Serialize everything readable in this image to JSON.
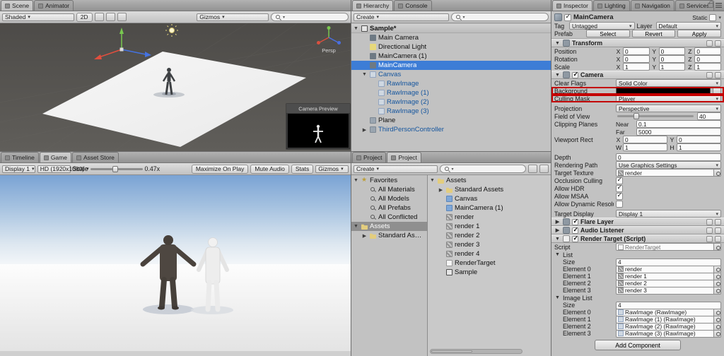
{
  "colors": {
    "selection_blue": "#3d7dd6",
    "annotation_red": "#c40000",
    "prefab_text_blue": "#14559e",
    "background_swatch": "#000000"
  },
  "scene": {
    "tabs": [
      {
        "label": "Scene",
        "active": true
      },
      {
        "label": "Animator"
      }
    ],
    "toolbar": {
      "shaded": "Shaded",
      "two_d": "2D",
      "gizmos": "Gizmos"
    },
    "persp": "Persp",
    "camera_preview": "Camera Preview"
  },
  "game": {
    "tabs": [
      {
        "label": "Timeline"
      },
      {
        "label": "Game",
        "active": true
      },
      {
        "label": "Asset Store"
      }
    ],
    "toolbar": {
      "display": "Display 1",
      "resolution": "HD (1920x1080)",
      "scale_label": "Scale",
      "scale_value": "0.47x",
      "maximize": "Maximize On Play",
      "mute": "Mute Audio",
      "stats": "Stats",
      "gizmos": "Gizmos"
    }
  },
  "hierarchy": {
    "tabs": [
      {
        "label": "Hierarchy",
        "active": true
      },
      {
        "label": "Console"
      }
    ],
    "create": "Create",
    "items": [
      {
        "label": "Sample*",
        "depth": 0,
        "arrow": "▼",
        "icon": "scene",
        "bold": true,
        "header": true
      },
      {
        "label": "Main Camera",
        "depth": 1,
        "icon": "camera"
      },
      {
        "label": "Directional Light",
        "depth": 1,
        "icon": "light"
      },
      {
        "label": "MainCamera (1)",
        "depth": 1,
        "icon": "camera"
      },
      {
        "label": "MainCamera",
        "depth": 1,
        "icon": "camera",
        "selected": true
      },
      {
        "label": "Canvas",
        "depth": 1,
        "arrow": "▼",
        "icon": "ui",
        "blue": true
      },
      {
        "label": "RawImage",
        "depth": 2,
        "icon": "ui",
        "blue": true
      },
      {
        "label": "RawImage (1)",
        "depth": 2,
        "icon": "ui",
        "blue": true
      },
      {
        "label": "RawImage (2)",
        "depth": 2,
        "icon": "ui",
        "blue": true
      },
      {
        "label": "RawImage (3)",
        "depth": 2,
        "icon": "ui",
        "blue": true
      },
      {
        "label": "Plane",
        "depth": 1,
        "icon": "cube"
      },
      {
        "label": "ThirdPersonController",
        "depth": 1,
        "arrow": "▶",
        "icon": "cube",
        "blue": true
      }
    ]
  },
  "project": {
    "tabs": [
      {
        "label": "Project"
      },
      {
        "label": "Project",
        "active": true
      }
    ],
    "create": "Create",
    "left_items": [
      {
        "label": "Favorites",
        "depth": 0,
        "arrow": "▼",
        "icon": "star"
      },
      {
        "label": "All Materials",
        "depth": 1,
        "icon": "search"
      },
      {
        "label": "All Models",
        "depth": 1,
        "icon": "search"
      },
      {
        "label": "All Prefabs",
        "depth": 1,
        "icon": "search"
      },
      {
        "label": "All Conflicted",
        "depth": 1,
        "icon": "search"
      },
      {
        "label": "Assets",
        "depth": 0,
        "arrow": "▼",
        "icon": "folder",
        "gray_sel": true
      },
      {
        "label": "Standard Assets",
        "depth": 1,
        "arrow": "▶",
        "icon": "folder"
      }
    ],
    "right_items": [
      {
        "label": "Assets",
        "depth": 0,
        "arrow": "▼",
        "icon": "folder"
      },
      {
        "label": "Standard Assets",
        "depth": 1,
        "arrow": "▶",
        "icon": "folder"
      },
      {
        "label": "Canvas",
        "depth": 1,
        "icon": "prefab"
      },
      {
        "label": "MainCamera (1)",
        "depth": 1,
        "icon": "prefab"
      },
      {
        "label": "render",
        "depth": 1,
        "icon": "rendertex"
      },
      {
        "label": "render 1",
        "depth": 1,
        "icon": "rendertex"
      },
      {
        "label": "render 2",
        "depth": 1,
        "icon": "rendertex"
      },
      {
        "label": "render 3",
        "depth": 1,
        "icon": "rendertex"
      },
      {
        "label": "render 4",
        "depth": 1,
        "icon": "rendertex"
      },
      {
        "label": "RenderTarget",
        "depth": 1,
        "icon": "script"
      },
      {
        "label": "Sample",
        "depth": 1,
        "icon": "scene"
      }
    ]
  },
  "inspector": {
    "tabs": [
      {
        "label": "Inspector",
        "active": true
      },
      {
        "label": "Lighting"
      },
      {
        "label": "Navigation"
      },
      {
        "label": "Services"
      }
    ],
    "header": {
      "name": "MainCamera",
      "static_label": "Static"
    },
    "tag_row": {
      "tag_label": "Tag",
      "tag_value": "Untagged",
      "layer_label": "Layer",
      "layer_value": "Default"
    },
    "prefab_row": {
      "label": "Prefab",
      "select": "Select",
      "revert": "Revert",
      "apply": "Apply"
    },
    "transform": {
      "title": "Transform",
      "rows": [
        {
          "label": "Position",
          "x_label": "X",
          "x": "0",
          "y_label": "Y",
          "y": "0",
          "z_label": "Z",
          "z": "0"
        },
        {
          "label": "Rotation",
          "x_label": "X",
          "x": "0",
          "y_label": "Y",
          "y": "0",
          "z_label": "Z",
          "z": "0"
        },
        {
          "label": "Scale",
          "x_label": "X",
          "x": "1",
          "y_label": "Y",
          "y": "1",
          "z_label": "Z",
          "z": "1"
        }
      ]
    },
    "camera": {
      "title": "Camera",
      "clear_flags_label": "Clear Flags",
      "clear_flags_value": "Solid Color",
      "background_label": "Background",
      "culling_mask_label": "Culling Mask",
      "culling_mask_value": "Player",
      "projection_label": "Projection",
      "projection_value": "Perspective",
      "fov_label": "Field of View",
      "fov_value": "40",
      "clipping_label": "Clipping Planes",
      "near_label": "Near",
      "near_value": "0.1",
      "far_label": "Far",
      "far_value": "5000",
      "viewport_label": "Viewport Rect",
      "vx_label": "X",
      "vx_value": "0",
      "vy_label": "Y",
      "vy_value": "0",
      "vw_label": "W",
      "vw_value": "1",
      "vh_label": "H",
      "vh_value": "1",
      "depth_label": "Depth",
      "depth_value": "0",
      "rendering_path_label": "Rendering Path",
      "rendering_path_value": "Use Graphics Settings",
      "target_texture_label": "Target Texture",
      "target_texture_value": "render",
      "occlusion_label": "Occlusion Culling",
      "hdr_label": "Allow HDR",
      "msaa_label": "Allow MSAA",
      "dynres_label": "Allow Dynamic Resolution",
      "target_display_label": "Target Display",
      "target_display_value": "Display 1"
    },
    "flare": {
      "title": "Flare Layer"
    },
    "audio": {
      "title": "Audio Listener"
    },
    "render_target": {
      "title": "Render Target (Script)",
      "script_label": "Script",
      "script_value": "RenderTarget",
      "list_label": "List",
      "size_label": "Size",
      "list_size": "4",
      "list_elements": [
        {
          "label": "Element 0",
          "value": "render"
        },
        {
          "label": "Element 1",
          "value": "render 1"
        },
        {
          "label": "Element 2",
          "value": "render 2"
        },
        {
          "label": "Element 3",
          "value": "render 3"
        }
      ],
      "image_list_label": "Image List",
      "image_size": "4",
      "image_elements": [
        {
          "label": "Element 0",
          "value": "RawImage (RawImage)"
        },
        {
          "label": "Element 1",
          "value": "RawImage (1) (RawImage)"
        },
        {
          "label": "Element 2",
          "value": "RawImage (2) (RawImage)"
        },
        {
          "label": "Element 3",
          "value": "RawImage (3) (RawImage)"
        }
      ]
    },
    "add_component": "Add Component"
  }
}
